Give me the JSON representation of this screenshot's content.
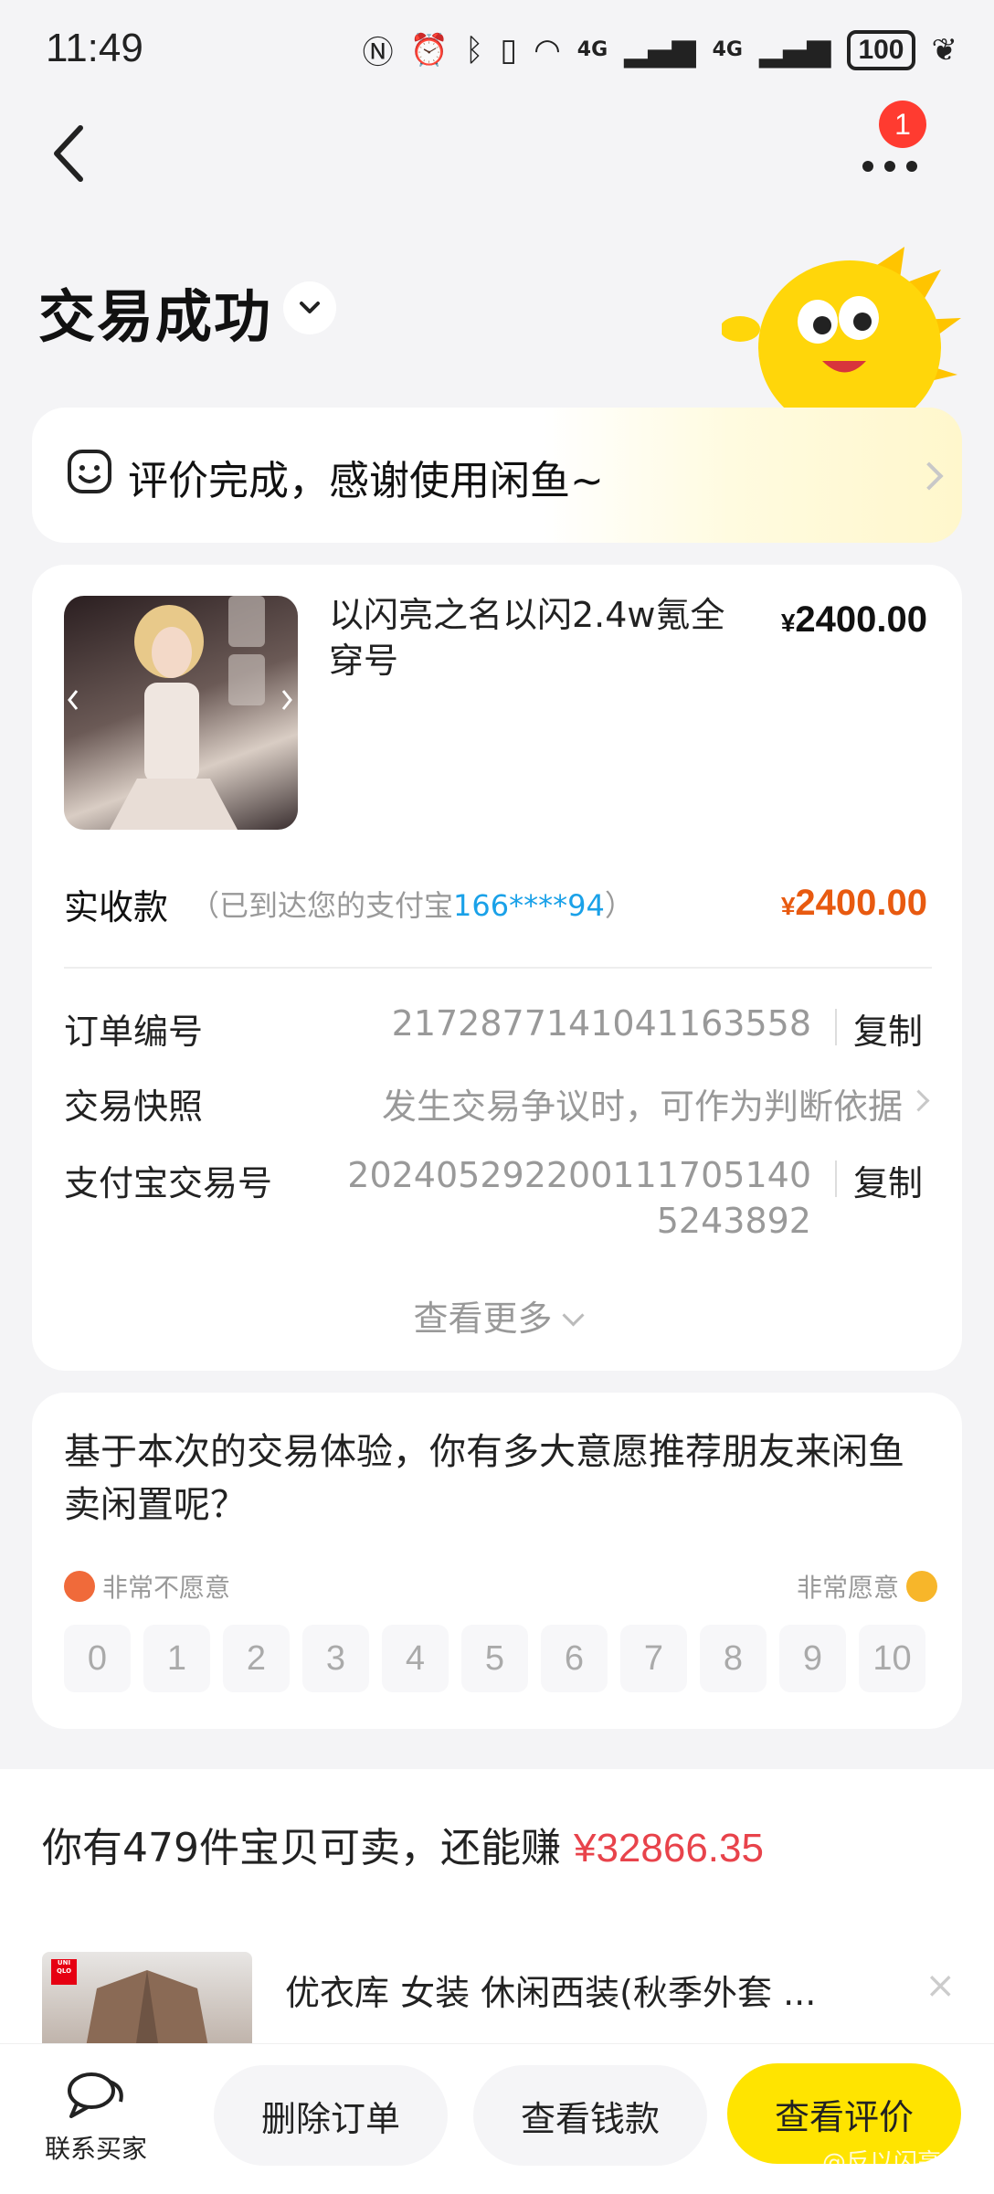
{
  "status_bar": {
    "time": "11:49",
    "battery": "100",
    "network1": "4G",
    "network2": "4G"
  },
  "nav": {
    "back_icon": "chevron-left-icon",
    "more_icon": "more-dots-icon",
    "badge_count": "1"
  },
  "header": {
    "title": "交易成功"
  },
  "review_banner": {
    "text": "评价完成，感谢使用闲鱼~"
  },
  "product": {
    "title": "以闪亮之名以闪2.4w氪全穿号",
    "price_symbol": "¥",
    "price": "2400.00"
  },
  "received": {
    "label": "实收款",
    "note_prefix": "（已到达您的支付宝",
    "account": "166****94",
    "note_suffix": "）",
    "price_symbol": "¥",
    "amount": "2400.00"
  },
  "details": {
    "order_no_label": "订单编号",
    "order_no": "2172877141041163558",
    "snapshot_label": "交易快照",
    "snapshot_value": "发生交易争议时，可作为判断依据",
    "alipay_label": "支付宝交易号",
    "alipay_line1": "20240529220011170514​0",
    "alipay_line2": "5243892",
    "copy_label": "复制",
    "see_more": "查看更多"
  },
  "survey": {
    "question": "基于本次的交易体验，你有多大意愿推荐朋友来闲鱼卖闲置呢？",
    "low_label": "非常不愿意",
    "high_label": "非常愿意",
    "scale": [
      "0",
      "1",
      "2",
      "3",
      "4",
      "5",
      "6",
      "7",
      "8",
      "9",
      "10"
    ]
  },
  "sell_prompt": {
    "prefix": "你有479件宝贝可卖，还能赚 ",
    "amount": "¥32866.35"
  },
  "recommend": {
    "title": "优衣库 女装 休闲西装(秋季外套 ...",
    "brand_logo": "UNI QLO",
    "close": "×"
  },
  "bottom_bar": {
    "contact_label": "联系买家",
    "delete_label": "删除订单",
    "money_label": "查看钱款",
    "review_label": "查看评价",
    "watermark": "@反以闪亮之名"
  },
  "colors": {
    "accent_yellow": "#ffe400",
    "price_orange": "#e85a10",
    "link_blue": "#1aa1e8",
    "sell_red": "#e8434b",
    "badge_red": "#ff3b30"
  }
}
